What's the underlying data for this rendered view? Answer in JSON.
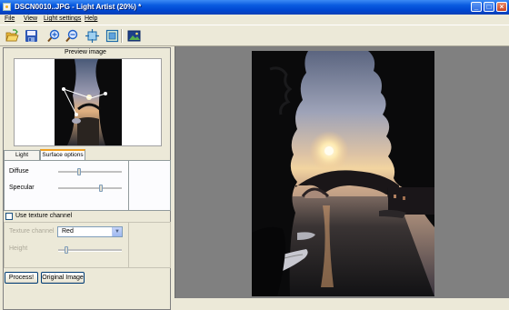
{
  "window": {
    "title": "DSCN0010..JPG - Light Artist (20%) *",
    "minimize_icon": "minimize-icon",
    "maximize_icon": "maximize-icon",
    "close_icon": "close-icon"
  },
  "menu": [
    {
      "label": "File"
    },
    {
      "label": "View"
    },
    {
      "label": "Light settings"
    },
    {
      "label": "Help"
    }
  ],
  "toolbar": [
    {
      "icon": "open-folder-icon"
    },
    {
      "icon": "save-disk-icon"
    },
    {
      "icon": "zoom-in-icon"
    },
    {
      "icon": "zoom-out-icon"
    },
    {
      "icon": "fit-window-icon"
    },
    {
      "icon": "actual-size-icon"
    },
    {
      "icon": "image-icon"
    }
  ],
  "preview": {
    "label": "Preview image"
  },
  "tabs": {
    "light_sources": "Light sources",
    "surface_options": "Surface options",
    "active": "Surface options"
  },
  "surface": {
    "diffuse_label": "Diffuse",
    "diffuse_value": 0.32,
    "specular_label": "Specular",
    "specular_value": 0.68
  },
  "texture": {
    "use_label": "Use texture channel",
    "checked": false,
    "channel_label": "Texture channel",
    "channel_value": "Red",
    "height_label": "Height",
    "height_value": 0.1
  },
  "buttons": {
    "process": "Process!",
    "original": "Original Image"
  },
  "colors": {
    "titlebar": "#0a5ce0",
    "panel": "#ece9d8",
    "canvas": "#808080",
    "tab_highlight": "#f0a020"
  }
}
